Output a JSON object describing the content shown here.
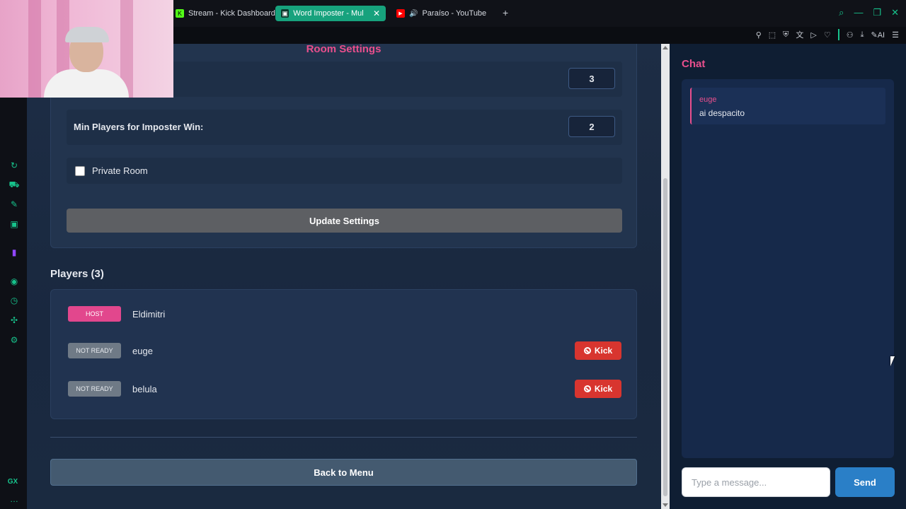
{
  "browser": {
    "tabs": [
      {
        "label": "Stream - Kick Dashboard",
        "active": false
      },
      {
        "label": "Word Imposter - Multi",
        "active": true
      },
      {
        "label": "Paraíso - YouTube",
        "active": false
      }
    ],
    "extensions": {
      "ai_label": "AI"
    },
    "accent_color": "#17c38c"
  },
  "sidebar": {
    "gx_label": "GX"
  },
  "room_settings": {
    "title": "Room Settings",
    "rows": [
      {
        "label": "",
        "value": "3"
      },
      {
        "label": "Min Players for Imposter Win:",
        "value": "2"
      }
    ],
    "private_room_label": "Private Room",
    "private_room_checked": false,
    "update_button": "Update Settings"
  },
  "players": {
    "title": "Players (3)",
    "list": [
      {
        "badge": "HOST",
        "name": "Eldimitri",
        "kickable": false
      },
      {
        "badge": "NOT READY",
        "name": "euge",
        "kickable": true
      },
      {
        "badge": "NOT READY",
        "name": "belula",
        "kickable": true
      }
    ],
    "kick_label": "Kick"
  },
  "back_button": "Back to Menu",
  "chat": {
    "title": "Chat",
    "messages": [
      {
        "user": "euge",
        "text": "ai despacito"
      }
    ],
    "input_placeholder": "Type a message...",
    "send_label": "Send"
  },
  "colors": {
    "pink": "#e94f8d",
    "kick_red": "#d8352f",
    "send_blue": "#2a7fc7"
  }
}
